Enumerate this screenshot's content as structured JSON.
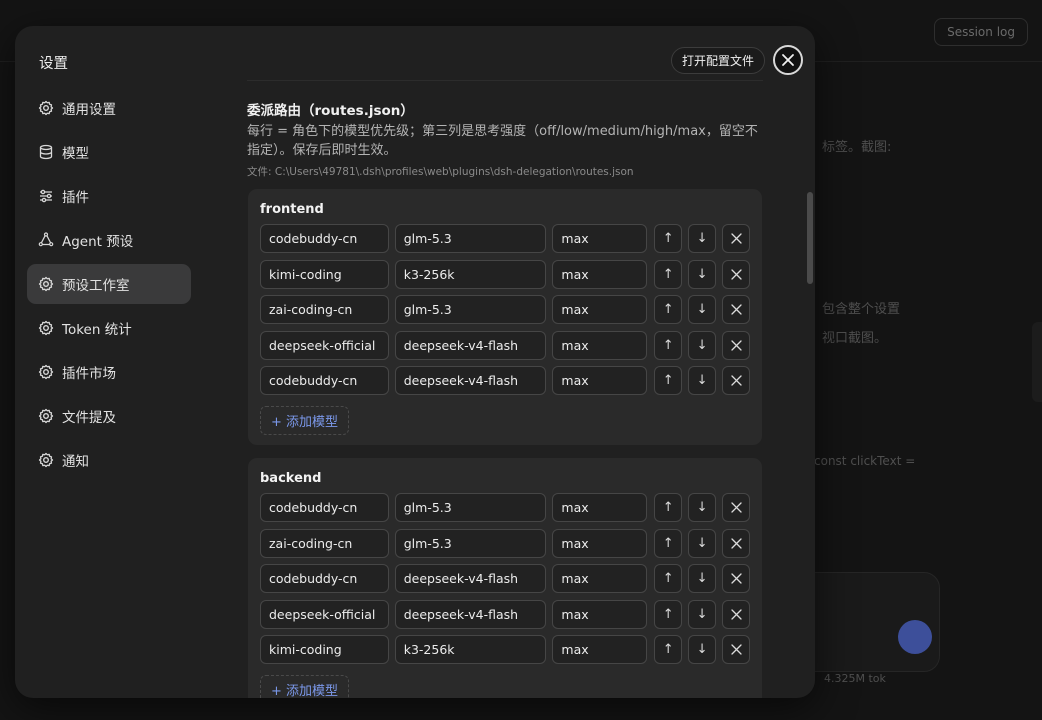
{
  "background": {
    "session_button": "Session log",
    "snippets": [
      "标签。截图:",
      "包含整个设置",
      "视口截图。",
      "const clickText =",
      "4.325M tok"
    ]
  },
  "modal": {
    "title": "设置",
    "open_config_label": "打开配置文件",
    "sidebar": {
      "items": [
        {
          "label": "通用设置",
          "icon": "gear-icon"
        },
        {
          "label": "模型",
          "icon": "database-icon"
        },
        {
          "label": "插件",
          "icon": "sliders-icon"
        },
        {
          "label": "Agent 预设",
          "icon": "agent-icon"
        },
        {
          "label": "预设工作室",
          "icon": "gear-icon",
          "active": true
        },
        {
          "label": "Token 统计",
          "icon": "gear-icon"
        },
        {
          "label": "插件市场",
          "icon": "gear-icon"
        },
        {
          "label": "文件提及",
          "icon": "gear-icon"
        },
        {
          "label": "通知",
          "icon": "gear-icon"
        }
      ]
    },
    "section": {
      "title": "委派路由（routes.json）",
      "description": "每行 = 角色下的模型优先级；第三列是思考强度（off/low/medium/high/max，留空不指定）。保存后即时生效。",
      "file_path": "文件: C:\\Users\\49781\\.dsh\\profiles\\web\\plugins\\dsh-delegation\\routes.json"
    },
    "add_model_label": "+ 添加模型",
    "roles": [
      {
        "name": "frontend",
        "routes": [
          {
            "provider": "codebuddy-cn",
            "model": "glm-5.3",
            "effort": "max"
          },
          {
            "provider": "kimi-coding",
            "model": "k3-256k",
            "effort": "max"
          },
          {
            "provider": "zai-coding-cn",
            "model": "glm-5.3",
            "effort": "max"
          },
          {
            "provider": "deepseek-official",
            "model": "deepseek-v4-flash",
            "effort": "max"
          },
          {
            "provider": "codebuddy-cn",
            "model": "deepseek-v4-flash",
            "effort": "max"
          }
        ]
      },
      {
        "name": "backend",
        "routes": [
          {
            "provider": "codebuddy-cn",
            "model": "glm-5.3",
            "effort": "max"
          },
          {
            "provider": "zai-coding-cn",
            "model": "glm-5.3",
            "effort": "max"
          },
          {
            "provider": "codebuddy-cn",
            "model": "deepseek-v4-flash",
            "effort": "max"
          },
          {
            "provider": "deepseek-official",
            "model": "deepseek-v4-flash",
            "effort": "max"
          },
          {
            "provider": "kimi-coding",
            "model": "k3-256k",
            "effort": "max"
          }
        ]
      }
    ],
    "row_buttons": {
      "up": "↑",
      "down": "↓"
    }
  }
}
